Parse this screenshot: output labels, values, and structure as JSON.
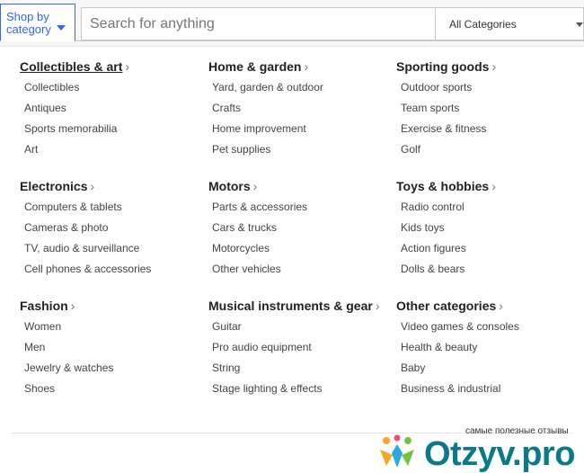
{
  "header": {
    "shop_by_category": "Shop by category",
    "search_placeholder": "Search for anything",
    "category_select": "All Categories"
  },
  "categories": [
    {
      "title": "Collectibles & art",
      "items": [
        "Collectibles",
        "Antiques",
        "Sports memorabilia",
        "Art"
      ]
    },
    {
      "title": "Home & garden",
      "items": [
        "Yard, garden & outdoor",
        "Crafts",
        "Home improvement",
        "Pet supplies"
      ]
    },
    {
      "title": "Sporting goods",
      "items": [
        "Outdoor sports",
        "Team sports",
        "Exercise & fitness",
        "Golf"
      ]
    },
    {
      "title": "Electronics",
      "items": [
        "Computers & tablets",
        "Cameras & photo",
        "TV, audio & surveillance",
        "Cell phones & accessories"
      ]
    },
    {
      "title": "Motors",
      "items": [
        "Parts & accessories",
        "Cars & trucks",
        "Motorcycles",
        "Other vehicles"
      ]
    },
    {
      "title": "Toys & hobbies",
      "items": [
        "Radio control",
        "Kids toys",
        "Action figures",
        "Dolls & bears"
      ]
    },
    {
      "title": "Fashion",
      "items": [
        "Women",
        "Men",
        "Jewelry & watches",
        "Shoes"
      ]
    },
    {
      "title": "Musical instruments & gear",
      "items": [
        "Guitar",
        "Pro audio equipment",
        "String",
        "Stage lighting & effects"
      ]
    },
    {
      "title": "Other categories",
      "items": [
        "Video games & consoles",
        "Health & beauty",
        "Baby",
        "Business & industrial"
      ]
    }
  ],
  "watermark": {
    "tagline": "самые полезные отзывы",
    "logo": "Otzyv.pro"
  },
  "colors": {
    "accent": "#3665f3",
    "heading": "#222222",
    "item": "#444444",
    "watermark": "#0a7a8a"
  }
}
